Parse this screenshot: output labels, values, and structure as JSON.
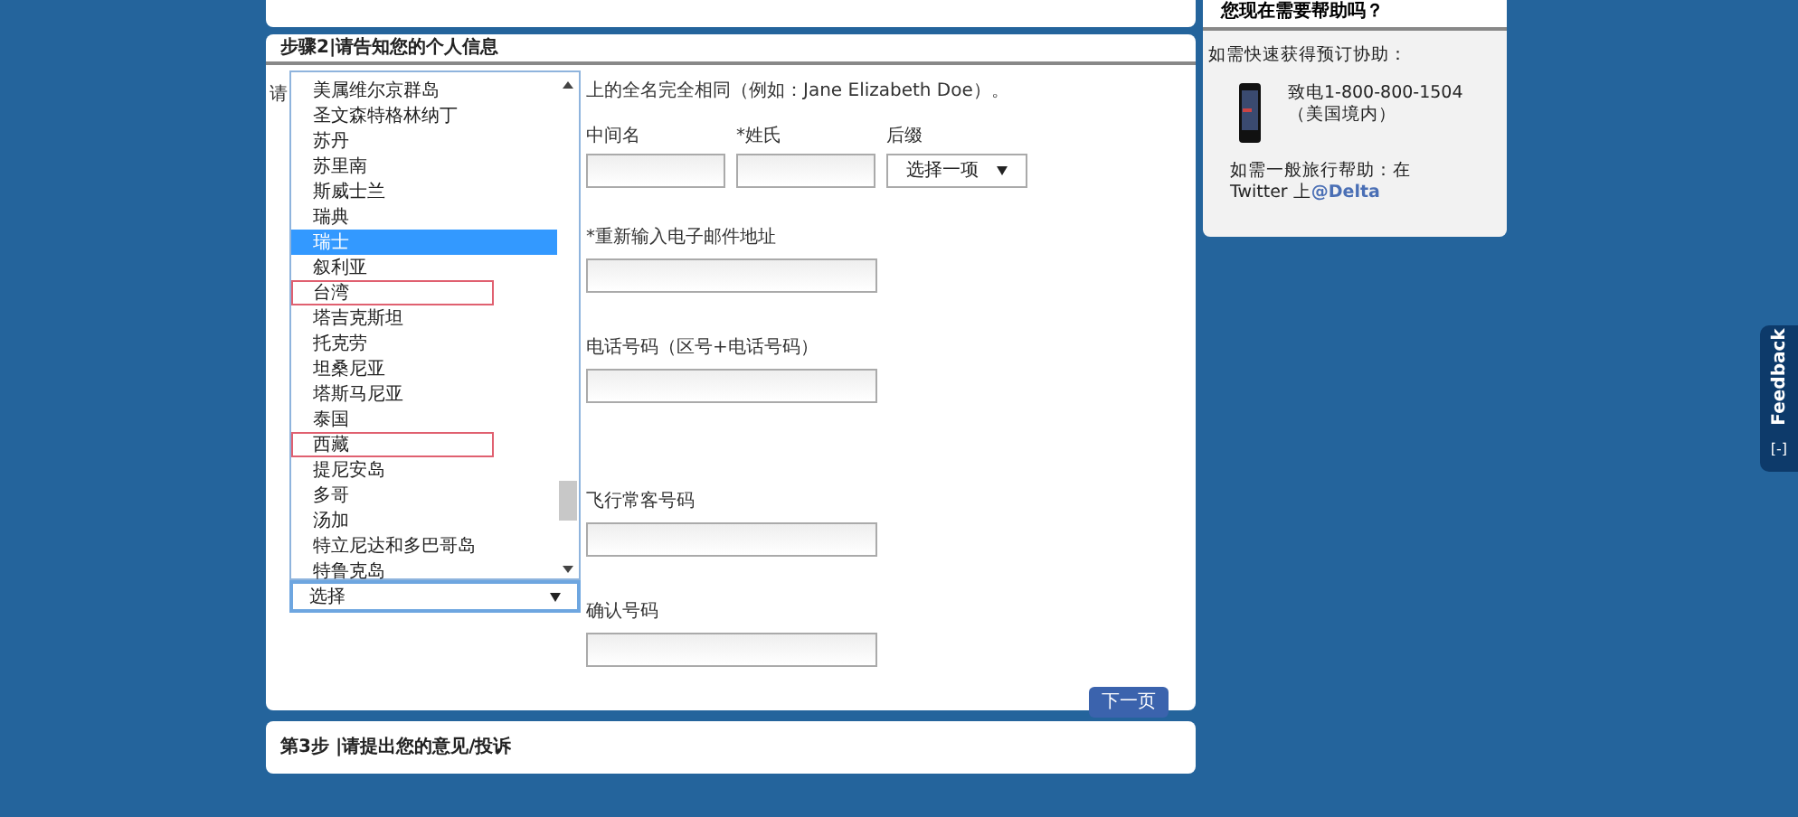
{
  "step2": {
    "title": "步骤2|请告知您的个人信息",
    "intro_start": "请",
    "intro_rest": "上的全名完全相同（例如：Jane Elizabeth Doe）。",
    "country_list": [
      {
        "label": "美属维尔京群岛",
        "selected": false,
        "flagged": false
      },
      {
        "label": "圣文森特格林纳丁",
        "selected": false,
        "flagged": false
      },
      {
        "label": "苏丹",
        "selected": false,
        "flagged": false
      },
      {
        "label": "苏里南",
        "selected": false,
        "flagged": false
      },
      {
        "label": "斯威士兰",
        "selected": false,
        "flagged": false
      },
      {
        "label": "瑞典",
        "selected": false,
        "flagged": false
      },
      {
        "label": "瑞士",
        "selected": true,
        "flagged": false
      },
      {
        "label": "叙利亚",
        "selected": false,
        "flagged": false
      },
      {
        "label": "台湾",
        "selected": false,
        "flagged": true
      },
      {
        "label": "塔吉克斯坦",
        "selected": false,
        "flagged": false
      },
      {
        "label": "托克劳",
        "selected": false,
        "flagged": false
      },
      {
        "label": "坦桑尼亚",
        "selected": false,
        "flagged": false
      },
      {
        "label": "塔斯马尼亚",
        "selected": false,
        "flagged": false
      },
      {
        "label": "泰国",
        "selected": false,
        "flagged": false
      },
      {
        "label": "西藏",
        "selected": false,
        "flagged": true
      },
      {
        "label": "提尼安岛",
        "selected": false,
        "flagged": false
      },
      {
        "label": "多哥",
        "selected": false,
        "flagged": false
      },
      {
        "label": "汤加",
        "selected": false,
        "flagged": false
      },
      {
        "label": "特立尼达和多巴哥岛",
        "selected": false,
        "flagged": false
      },
      {
        "label": "特鲁克岛",
        "selected": false,
        "flagged": false
      }
    ],
    "country_select": {
      "value": "选择"
    },
    "name_fields": [
      {
        "label": "中间名",
        "kind": "text"
      },
      {
        "label": "*姓氏",
        "kind": "text"
      },
      {
        "label": "后缀",
        "kind": "select",
        "value": "选择一项"
      }
    ],
    "fields": [
      {
        "label": "*重新输入电子邮件地址"
      },
      {
        "label": "电话号码（区号+电话号码）"
      },
      {
        "label": "飞行常客号码"
      },
      {
        "label": "确认号码"
      }
    ],
    "next_button": "下一页"
  },
  "step3": {
    "title": "第3步 |请提出您的意见/投诉"
  },
  "help": {
    "title": "您现在需要帮助吗？",
    "quick": "如需快速获得预订协助：",
    "phone": "致电1-800-800-1504（美国境内）",
    "general": "如需一般旅行帮助：在Twitter 上",
    "twitter": "@Delta"
  },
  "feedback": {
    "label": "Feedback",
    "toggle": "[-]"
  }
}
